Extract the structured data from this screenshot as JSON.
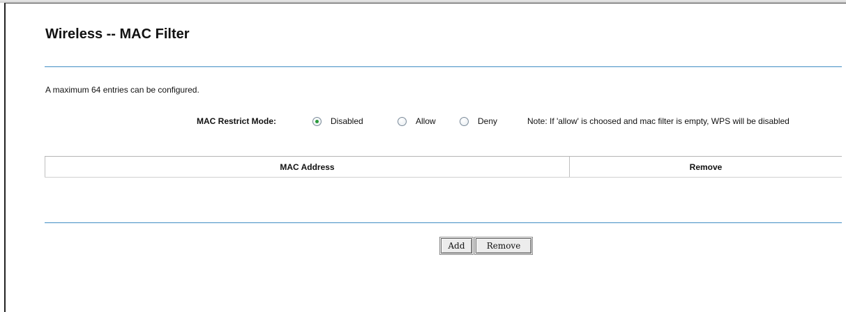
{
  "page": {
    "title": "Wireless -- MAC Filter",
    "max_entries_note": "A maximum 64 entries can be configured."
  },
  "restrict_mode": {
    "label": "MAC Restrict Mode:",
    "options": [
      {
        "label": "Disabled",
        "selected": true
      },
      {
        "label": "Allow",
        "selected": false
      },
      {
        "label": "Deny",
        "selected": false
      }
    ],
    "selected_value": "Disabled",
    "note": "Note: If 'allow' is choosed and mac filter is empty, WPS will be disabled"
  },
  "table": {
    "columns": [
      "MAC Address",
      "Remove"
    ],
    "rows": []
  },
  "actions": {
    "add_label": "Add",
    "remove_label": "Remove"
  },
  "colors": {
    "divider": "#6aa6cf",
    "radio_selected": "#2a9a3a"
  }
}
